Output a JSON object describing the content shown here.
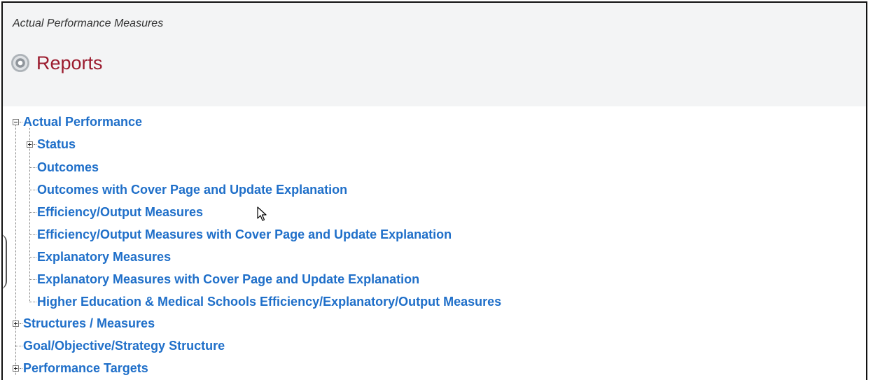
{
  "breadcrumb": "Actual Performance Measures",
  "page_title": "Reports",
  "icons": {
    "title": "gear-icon",
    "expand": "plus-box-icon",
    "collapse": "minus-box-icon"
  },
  "colors": {
    "link": "#1f6fc9",
    "title": "#9b1b2e",
    "header_bg": "#f3f4f5"
  },
  "tree": {
    "actual_performance": {
      "label": "Actual Performance",
      "children": {
        "status": "Status",
        "outcomes": "Outcomes",
        "outcomes_cover": "Outcomes with Cover Page and Update Explanation",
        "efficiency": "Efficiency/Output Measures",
        "efficiency_cover": "Efficiency/Output Measures with Cover Page and Update Explanation",
        "explanatory": "Explanatory Measures",
        "explanatory_cover": "Explanatory Measures with Cover Page and Update Explanation",
        "higher_ed": "Higher Education & Medical Schools Efficiency/Explanatory/Output Measures"
      }
    },
    "structures": "Structures / Measures",
    "goal_structure": "Goal/Objective/Strategy Structure",
    "performance_targets": "Performance Targets"
  }
}
